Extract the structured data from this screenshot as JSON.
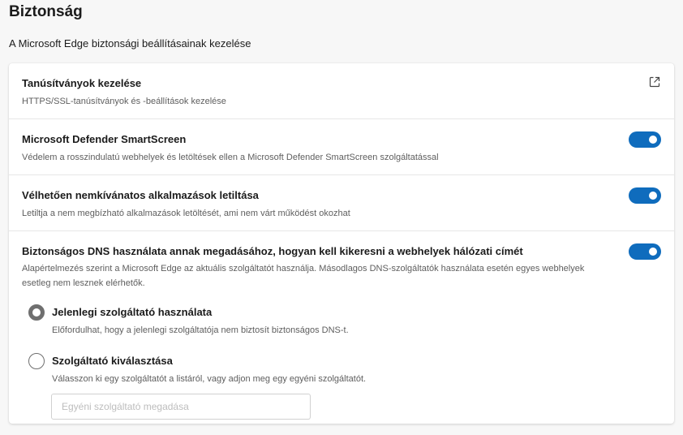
{
  "header": {
    "title": "Biztonság",
    "subtitle": "A Microsoft Edge biztonsági beállításainak kezelése"
  },
  "settings": {
    "certificates": {
      "title": "Tanúsítványok kezelése",
      "description": "HTTPS/SSL-tanúsítványok és -beállítások kezelése",
      "icon": "external-link-icon"
    },
    "smartscreen": {
      "title": "Microsoft Defender SmartScreen",
      "description": "Védelem a rosszindulatú webhelyek és letöltések ellen a Microsoft Defender SmartScreen szolgáltatással",
      "enabled": true
    },
    "pua": {
      "title": "Vélhetően nemkívánatos alkalmazások letiltása",
      "description": "Letiltja a nem megbízható alkalmazások letöltését, ami nem várt működést okozhat",
      "enabled": true
    },
    "secure_dns": {
      "title": "Biztonságos DNS használata annak megadásához, hogyan kell kikeresni a webhelyek hálózati címét",
      "description": "Alapértelmezés szerint a Microsoft Edge az aktuális szolgáltatót használja. Másodlagos DNS-szolgáltatók használata esetén egyes webhelyek esetleg nem lesznek elérhetők.",
      "enabled": true,
      "options": [
        {
          "label": "Jelenlegi szolgáltató használata",
          "description": "Előfordulhat, hogy a jelenlegi szolgáltatója nem biztosít biztonságos DNS-t.",
          "selected": true
        },
        {
          "label": "Szolgáltató kiválasztása",
          "description": "Válasszon ki egy szolgáltatót a listáról, vagy adjon meg egy egyéni szolgáltatót.",
          "selected": false
        }
      ],
      "custom_provider_placeholder": "Egyéni szolgáltató megadása"
    }
  },
  "colors": {
    "accent": "#0f6cbd",
    "radio": "#6f6f6f"
  }
}
